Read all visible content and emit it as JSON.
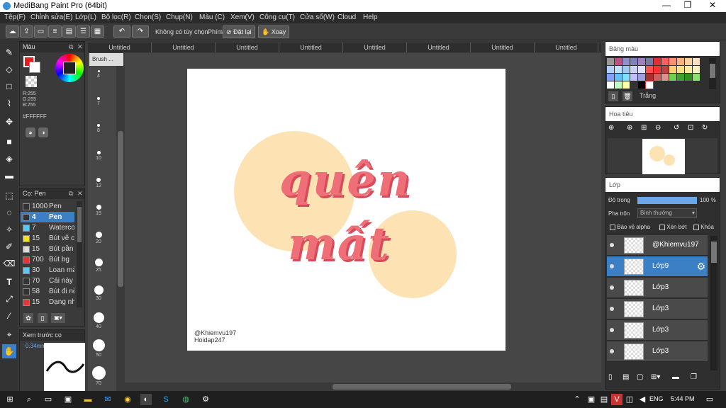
{
  "window": {
    "title": "MediBang Paint Pro (64bit)"
  },
  "menu": [
    "Tệp(F)",
    "Chỉnh sửa(E)",
    "Lớp(L)",
    "Bộ lọc(R)",
    "Chọn(S)",
    "Chụp(N)",
    "Màu (C)",
    "Xem(V)",
    "Công cụ(T)",
    "Cửa sổ(W)",
    "Cloud",
    "Help"
  ],
  "toolbar": {
    "no_option": "Không có tùy chọn",
    "key_label": "Phím",
    "reset": "Đặt lại",
    "rotate": "Xoay"
  },
  "tabs": [
    "Untitled",
    "Untitled",
    "Untitled",
    "Untitled",
    "Untitled",
    "Untitled",
    "Untitled",
    "Untitled"
  ],
  "color_panel": {
    "title": "Màu",
    "r": "R:255",
    "g": "G:255",
    "b": "B:255",
    "hex": "#FFFFFF"
  },
  "brush_panel": {
    "title": "Cọ: Pen",
    "items": [
      {
        "size": "1000",
        "name": "Pen",
        "swatch": "#333333",
        "selected": false
      },
      {
        "size": "4",
        "name": "Pen",
        "swatch": "#333333",
        "selected": true
      },
      {
        "size": "7",
        "name": "Waterco",
        "swatch": "#5bc8f5",
        "selected": false
      },
      {
        "size": "15",
        "name": "Bút vẽ c",
        "swatch": "#f5e02a",
        "selected": false
      },
      {
        "size": "15",
        "name": "Bút pần",
        "swatch": "#dddddd",
        "selected": false
      },
      {
        "size": "700",
        "name": "Bút bg",
        "swatch": "#e83434",
        "selected": false
      },
      {
        "size": "30",
        "name": "Loan mà",
        "swatch": "#5bc8f5",
        "selected": false
      },
      {
        "size": "70",
        "name": "Cái này c",
        "swatch": "#333333",
        "selected": false
      },
      {
        "size": "58",
        "name": "Bút đi nề",
        "swatch": "#333333",
        "selected": false
      },
      {
        "size": "15",
        "name": "Dạng nh",
        "swatch": "#e83434",
        "selected": false
      }
    ]
  },
  "preview": {
    "title": "Xem trước cọ",
    "size": "0.34mm"
  },
  "brush_strip": {
    "header": "Brush ...",
    "sizes": [
      "4",
      "7",
      "8",
      "10",
      "12",
      "15",
      "20",
      "25",
      "30",
      "40",
      "50",
      "70"
    ]
  },
  "canvas": {
    "word1": "quên",
    "word2": "mất",
    "credit1": "@Khiemvu197",
    "credit2": "Hoidap247"
  },
  "palette_panel": {
    "title": "Bảng màu",
    "selected_name": "Trắng"
  },
  "navigator_panel": {
    "title": "Hoa tiêu"
  },
  "layer_panel": {
    "title": "Lớp",
    "opacity_label": "Độ trong",
    "opacity_value": "100 %",
    "blend_label": "Pha trộn",
    "blend_value": "Bình thường",
    "protect_alpha": "Bảo vệ alpha",
    "clipping": "Xén bớt",
    "lock": "Khóa",
    "layers": [
      {
        "name": "@Khiemvu197",
        "selected": false
      },
      {
        "name": "Lớp9",
        "selected": true
      },
      {
        "name": "Lớp3",
        "selected": false
      },
      {
        "name": "Lớp3",
        "selected": false
      },
      {
        "name": "Lớp3",
        "selected": false
      },
      {
        "name": "Lớp3",
        "selected": false
      }
    ]
  },
  "taskbar": {
    "lang": "ENG",
    "time": "5:44 PM"
  },
  "colors": {
    "accent": "#3b7fc4",
    "circle": "#fde3b4",
    "text_pink": "#ef6f78"
  }
}
